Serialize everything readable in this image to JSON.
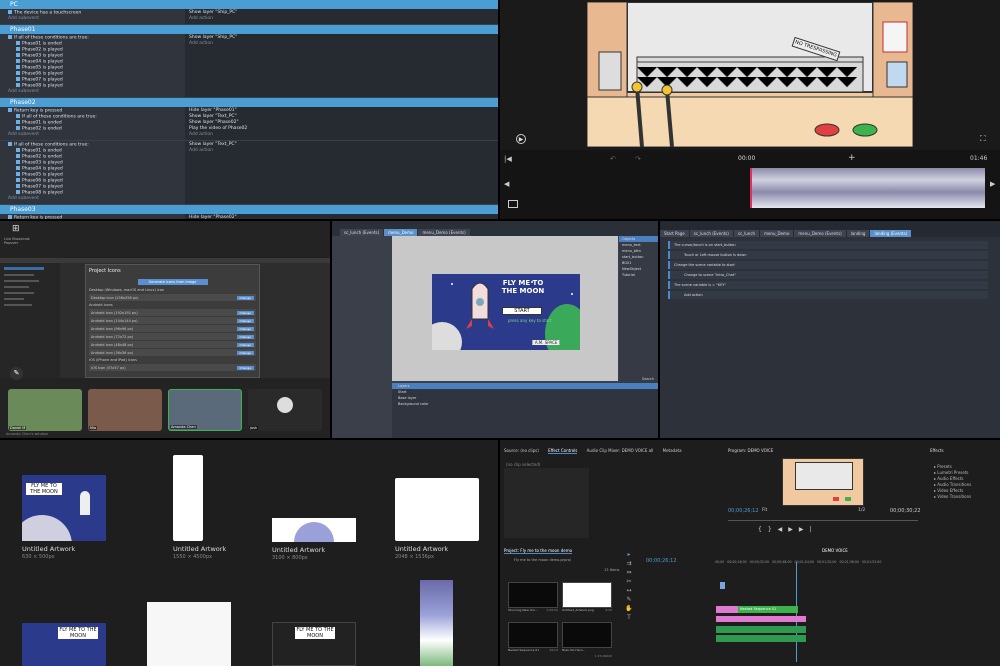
{
  "event_sheet": {
    "groups": [
      {
        "title": "PC",
        "rows": [
          {
            "cond": [
              "The device has a touchscreen"
            ],
            "act": [
              "Show layer \"Ship_PC\""
            ],
            "sub": "Add subevent",
            "addact": "Add action"
          }
        ]
      },
      {
        "title": "Phase01",
        "rows": [
          {
            "cond": [
              "If all of these conditions are true:",
              "Phase01 is ended",
              "Phase02 is played",
              "Phase03 is played",
              "Phase04 is played",
              "Phase05 is played",
              "Phase06 is played",
              "Phase07 is played",
              "Phase08 is played"
            ],
            "act": [
              "Show layer \"Ship_PC\""
            ],
            "sub": "Add subevent",
            "addact": "Add action"
          }
        ]
      },
      {
        "title": "Phase02",
        "rows": [
          {
            "cond": [
              "Return key is pressed",
              "If all of these conditions are true:",
              "Phase01 is ended",
              "Phase02 is ended"
            ],
            "act": [
              "Hide layer \"Phase01\"",
              "Show layer \"Text_PC\"",
              "Show layer \"Phase02\"",
              "Play the video of Phase02"
            ],
            "sub": "Add subevent",
            "addact": "Add action"
          },
          {
            "cond": [
              "If all of these conditions are true:",
              "Phase01 is ended",
              "Phase02 is ended",
              "Phase03 is played",
              "Phase04 is played",
              "Phase05 is played",
              "Phase06 is played",
              "Phase07 is played",
              "Phase08 is played"
            ],
            "act": [
              "Show layer \"Text_PC\""
            ],
            "sub": "Add subevent",
            "addact": "Add action"
          }
        ]
      },
      {
        "title": "Phase03",
        "rows": [
          {
            "cond": [
              "Return key is pressed",
              "If all of these conditions are true:",
              "Phase01 is ended",
              "Phase02 is ended"
            ],
            "act": [
              "Hide layer \"Phase02\"",
              "Show layer \"Text_PC\"",
              "Show layer \"Phase03\""
            ],
            "sub": "Add subevent",
            "addact": "Add action"
          }
        ]
      }
    ]
  },
  "video_player": {
    "current_time": "00:00",
    "duration": "01:46",
    "sign_text": "NO TRESPASSING"
  },
  "meeting": {
    "title": "Project Icons",
    "toolbar_label": "Live Broadcast Popover",
    "generate_label": "Generate icons from image",
    "desktop_heading": "Desktop (Windows, macOS and Linux) icon",
    "android_heading": "Android icons",
    "ios_heading": "iOS (iPhone and iPad) icons",
    "icons": [
      "Desktop icon (256x256 px)",
      "Android icon (192x192 px)",
      "Android icon (144x144 px)",
      "Android icon (96x96 px)",
      "Android icon (72x72 px)",
      "Android icon (48x48 px)",
      "Android icon (36x36 px)",
      "iOS Icon (57x57 px)"
    ],
    "change_label": "Change",
    "participants": [
      {
        "name": "Daniel M",
        "color": "#6a8a5a"
      },
      {
        "name": "Mia",
        "color": "#7a5a4a"
      },
      {
        "name": "Amanda Chen",
        "color": "#5a6a7a"
      },
      {
        "name": "josh",
        "color": "#2a2a2a"
      }
    ],
    "footer": "Amanda Chen's window"
  },
  "scene_editor": {
    "tabs": [
      "sc_lunch (Events)",
      "menu_Demo",
      "menu_Demo (Events)"
    ],
    "game_title": "FLY ME TO THE MOON",
    "start_label": "START",
    "subtitle": "press any key to start",
    "credit": "[ A.M. SPACE ]",
    "side_items": [
      "Objects",
      "menu_text",
      "menu_bttn",
      "start_button",
      "BG01",
      "NewObject",
      "Tutorial"
    ],
    "props": [
      "Layers",
      "Start",
      "Base layer",
      "Background color"
    ],
    "status": "Search"
  },
  "events_editor": {
    "tabs": [
      "Start Page",
      "sc_lunch (Events)",
      "sc_lunch",
      "menu_Demo",
      "menu_Demo (Events)",
      "landing",
      "landing (Events)"
    ],
    "lines": [
      "The cursor/touch is on start_button",
      "Touch or Left mouse button is down",
      "Change the scene variable to start",
      "Change to scene \"Intro_Chat\"",
      "The scene variable is = \"KEY\"",
      "Add action"
    ]
  },
  "artworks": [
    {
      "name": "Untitled Artwork",
      "size": "630 × 500px"
    },
    {
      "name": "Untitled Artwork",
      "size": "1550 × 4500px"
    },
    {
      "name": "Untitled Artwork",
      "size": "3100 × 800px"
    },
    {
      "name": "Untitled Artwork",
      "size": "2048 × 1536px"
    }
  ],
  "artwork_title": "FLY ME TO THE MOON",
  "premiere": {
    "source_tab": "Source: (no clips)",
    "effect_tab": "Effect Controls",
    "mixer_tab": "Audio Clip Mixer: DEMO VOICE all",
    "metadata_tab": "Metadata",
    "no_clip": "(no clip selected)",
    "program_tab": "Program: DEMO VOICE",
    "program_time": "00;00;26;12",
    "program_end": "00;00;30;22",
    "fit": "Fit",
    "ratio": "1/2",
    "project_tab": "Project: Fly me to the moon demo",
    "project_file": "Fly me to the moon demo.prproj",
    "items_count": "13 Items",
    "bins": [
      {
        "name": "Stunning New Uni...",
        "dur": "1;00;00"
      },
      {
        "name": "Untitled_Artwork.png",
        "dur": "4;29"
      },
      {
        "name": "Nested Sequence 01",
        "dur": "29;23"
      },
      {
        "name": "Boku No Hero...",
        "dur": "1;15;09646"
      }
    ],
    "timeline_tab": "DEMO VOICE",
    "timeline_time": "00;00;26;12",
    "ruler": [
      "00;00",
      "00;00;16;00",
      "00;00;32;00",
      "00;00;48;00",
      "00;01;04;00",
      "00;01;20;00",
      "00;01;36;00",
      "00;01;52;00"
    ],
    "clip_label": "Nested Sequence 01",
    "effects_tab": "Effects",
    "effects": [
      "Presets",
      "Lumetri Presets",
      "Audio Effects",
      "Audio Transitions",
      "Video Effects",
      "Video Transitions"
    ]
  }
}
